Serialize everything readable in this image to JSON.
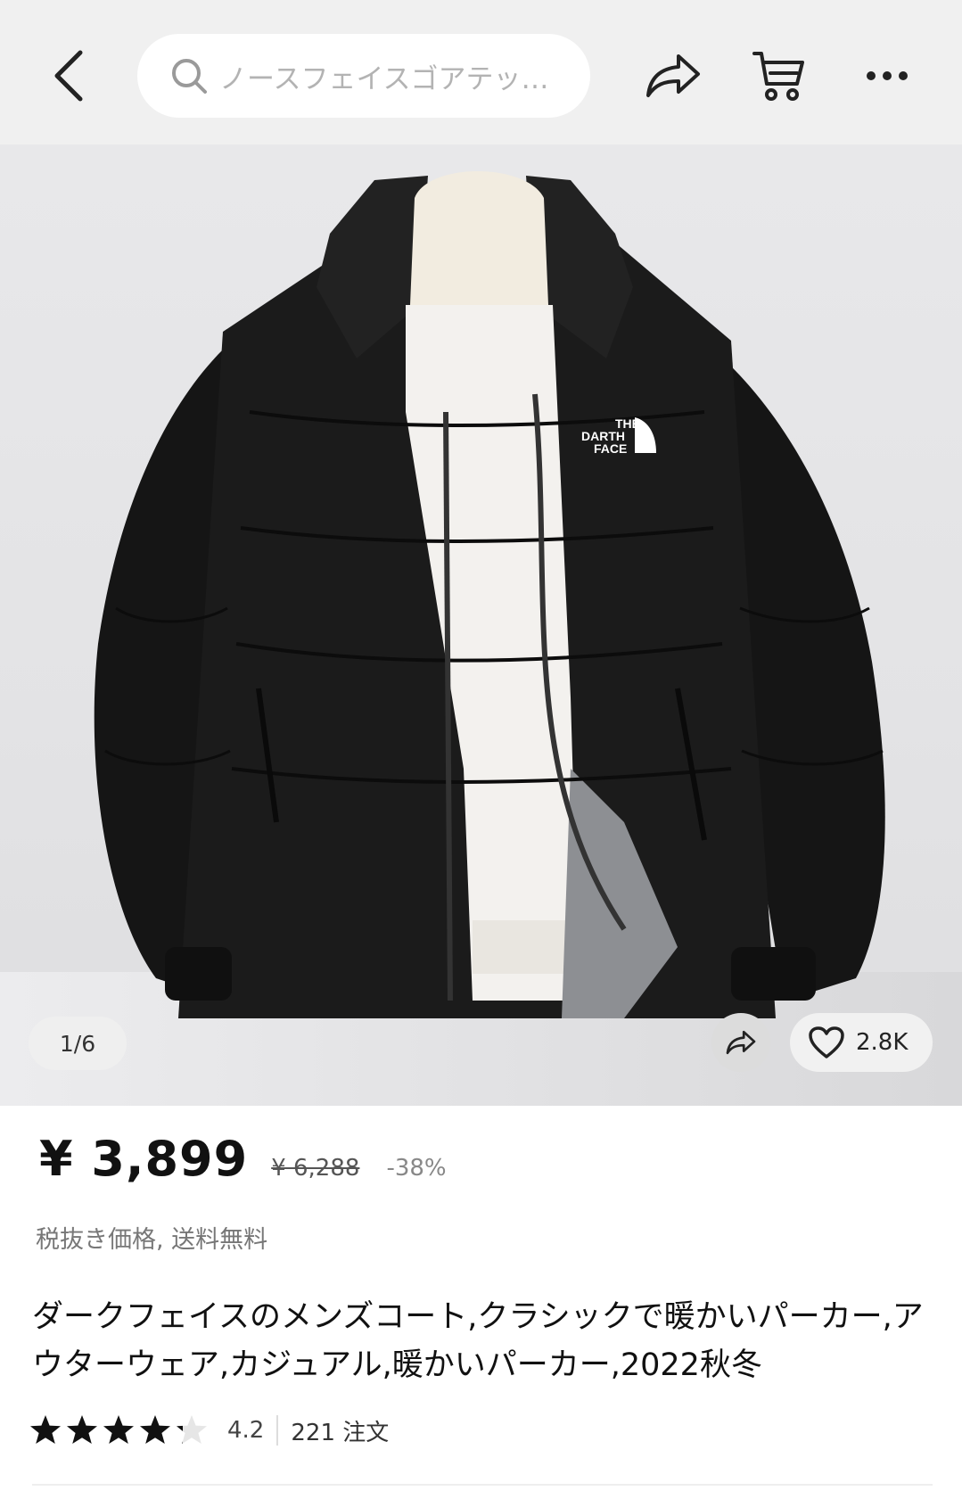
{
  "header": {
    "search_placeholder": "ノースフェイスゴアテッ…"
  },
  "gallery": {
    "counter": "1/6",
    "logo_line1": "THE",
    "logo_line2": "DARTH",
    "logo_line3": "FACE",
    "wishlist_count": "2.8K"
  },
  "product": {
    "price": "¥ 3,899",
    "old_price": "¥ 6,288",
    "discount": "-38%",
    "tax_note": "税抜き価格, 送料無料",
    "title": "ダークフェイスのメンズコート,クラシックで暖かいパーカー,アウターウェア,カジュアル,暖かいパーカー,2022秋冬",
    "rating": "4.2",
    "rating_value": 4.2,
    "orders": "221 注文"
  },
  "colors": {
    "header_bg": "#f0f0f0",
    "star": "#111111",
    "star_empty": "#e6e6e6"
  },
  "icons": [
    "chevron-left-icon",
    "search-icon",
    "share-icon",
    "cart-icon",
    "more-icon",
    "heart-icon",
    "star-icon"
  ]
}
